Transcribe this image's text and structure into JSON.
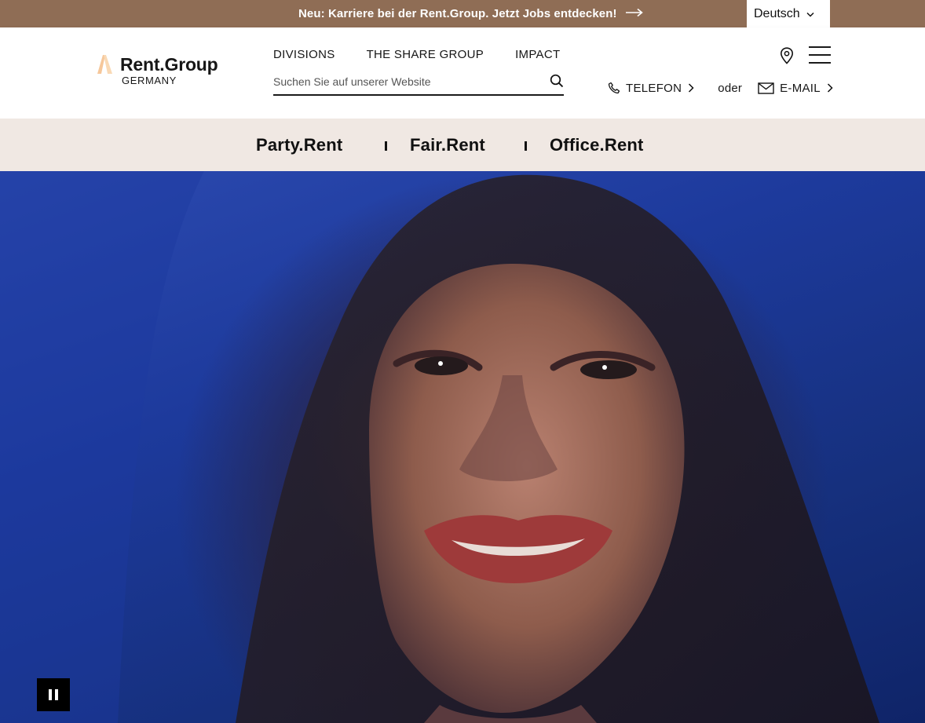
{
  "announcement": {
    "text": "Neu: Karriere bei der Rent.Group. Jetzt Jobs entdecken!",
    "arrow_icon": "long-arrow-right-icon"
  },
  "language": {
    "selected": "Deutsch"
  },
  "logo": {
    "brand": "Rent.Group",
    "country": "GERMANY"
  },
  "nav": {
    "items": [
      {
        "label": "DIVISIONS"
      },
      {
        "label": "THE SHARE GROUP"
      },
      {
        "label": "IMPACT"
      }
    ]
  },
  "search": {
    "placeholder": "Suchen Sie auf unserer Website"
  },
  "contact": {
    "phone_label": "TELEFON",
    "or": "oder",
    "email_label": "E-MAIL"
  },
  "divisions": [
    {
      "label": "Party.Rent"
    },
    {
      "label": "Fair.Rent"
    },
    {
      "label": "Office.Rent"
    }
  ],
  "colors": {
    "topbar": "#8f6d55",
    "divbar": "#f0e8e3",
    "accent": "#f0c090"
  }
}
